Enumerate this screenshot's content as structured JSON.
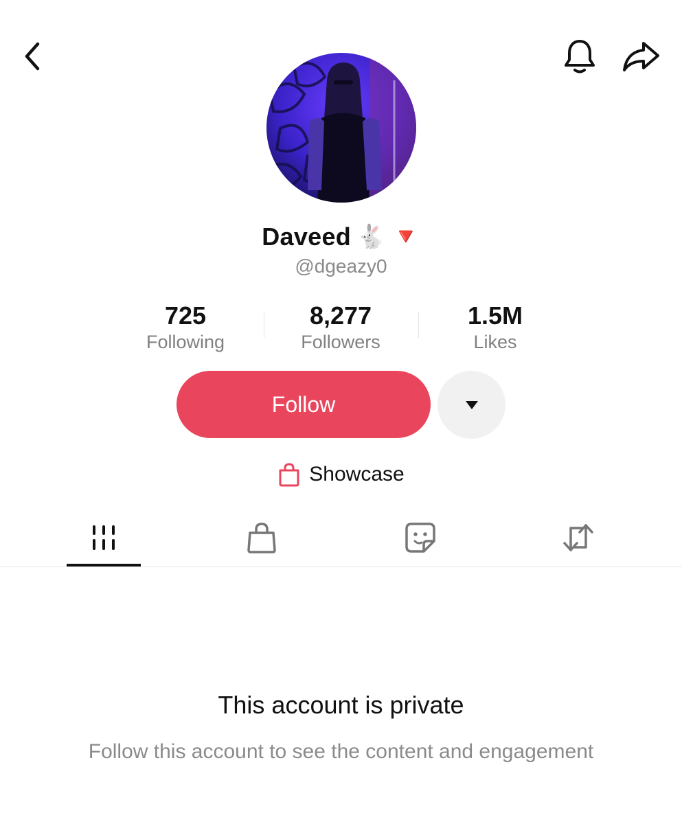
{
  "header": {
    "back_icon": "chevron-left-icon",
    "bell_icon": "bell-icon",
    "share_icon": "share-arrow-icon"
  },
  "profile": {
    "display_name": "Daveed",
    "name_emojis": [
      "🐇",
      "🔻"
    ],
    "username": "@dgeazy0"
  },
  "stats": [
    {
      "value": "725",
      "label": "Following"
    },
    {
      "value": "8,277",
      "label": "Followers"
    },
    {
      "value": "1.5M",
      "label": "Likes"
    }
  ],
  "actions": {
    "follow_label": "Follow",
    "more_icon": "caret-down-icon",
    "showcase_label": "Showcase",
    "showcase_icon": "shopping-bag-icon"
  },
  "tabs": [
    {
      "icon": "grid-videos-icon",
      "active": true
    },
    {
      "icon": "shopping-bag-icon",
      "active": false
    },
    {
      "icon": "sticker-icon",
      "active": false
    },
    {
      "icon": "repost-icon",
      "active": false
    }
  ],
  "private_notice": {
    "title": "This account is private",
    "subtitle": "Follow this account to see the content and engagement"
  },
  "colors": {
    "follow_button": "#e9455d",
    "more_button": "#f1f1f1",
    "muted_text": "#8a8a8a"
  }
}
